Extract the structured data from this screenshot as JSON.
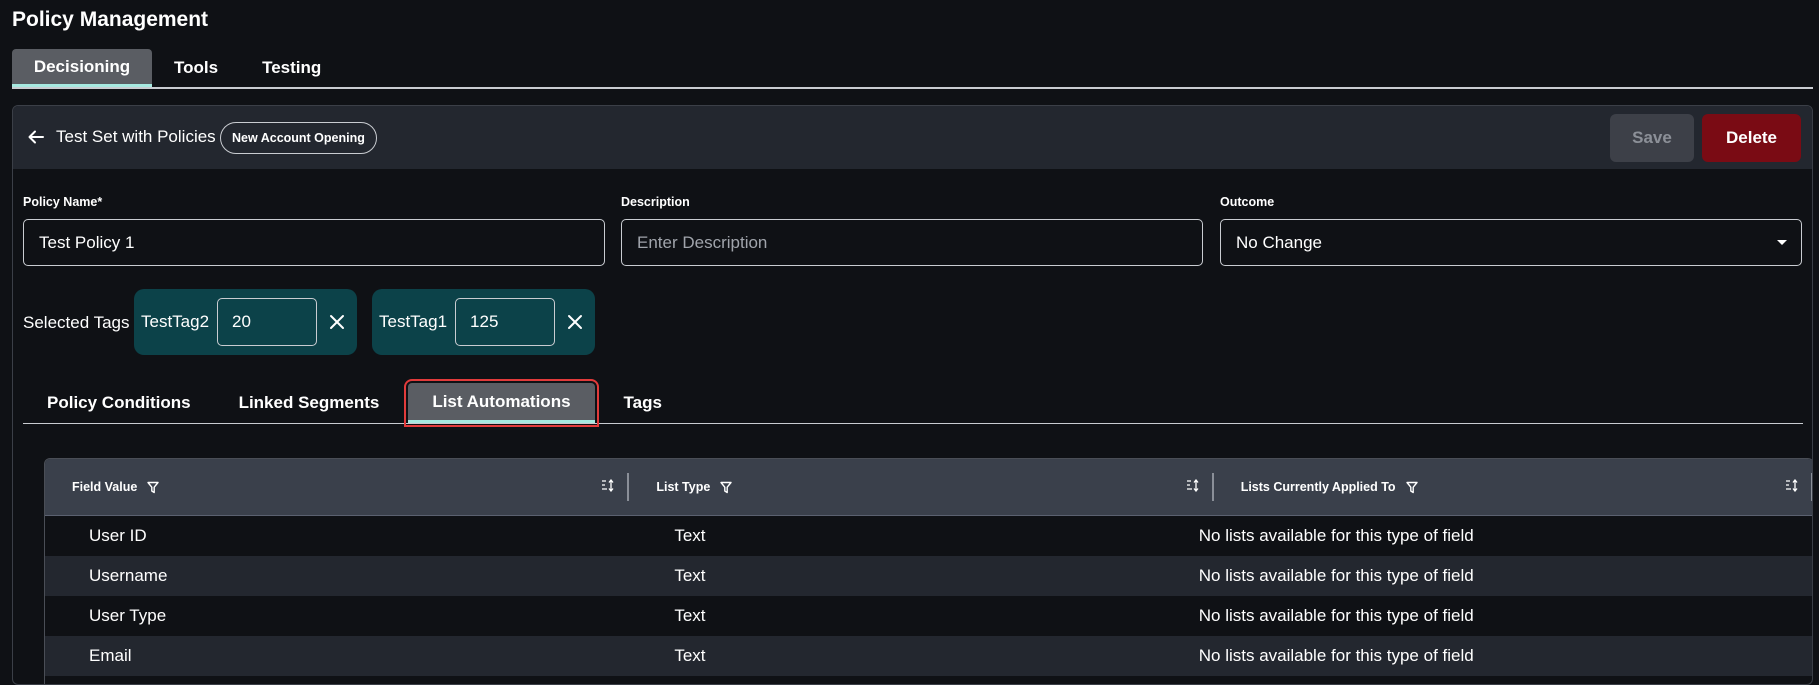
{
  "page_title": "Policy Management",
  "main_tabs": [
    {
      "label": "Decisioning",
      "active": true
    },
    {
      "label": "Tools",
      "active": false
    },
    {
      "label": "Testing",
      "active": false
    }
  ],
  "header": {
    "set_title": "Test Set with Policies",
    "badge": "New Account Opening",
    "save_label": "Save",
    "delete_label": "Delete"
  },
  "form": {
    "policy_name_label": "Policy Name*",
    "policy_name_value": "Test Policy 1",
    "description_label": "Description",
    "description_placeholder": "Enter Description",
    "outcome_label": "Outcome",
    "outcome_value": "No Change"
  },
  "tags": {
    "label": "Selected Tags",
    "items": [
      {
        "name": "TestTag2",
        "value": "20"
      },
      {
        "name": "TestTag1",
        "value": "125"
      }
    ]
  },
  "sub_tabs": [
    {
      "label": "Policy Conditions",
      "active": false
    },
    {
      "label": "Linked Segments",
      "active": false
    },
    {
      "label": "List Automations",
      "active": true
    },
    {
      "label": "Tags",
      "active": false
    }
  ],
  "grid": {
    "columns": [
      "Field Value",
      "List Type",
      "Lists Currently Applied To"
    ],
    "rows": [
      [
        "User ID",
        "Text",
        "No lists available for this type of field"
      ],
      [
        "Username",
        "Text",
        "No lists available for this type of field"
      ],
      [
        "User Type",
        "Text",
        "No lists available for this type of field"
      ],
      [
        "Email",
        "Text",
        "No lists available for this type of field"
      ]
    ]
  },
  "colors": {
    "background": "#0f1115",
    "header_bg": "#23272f",
    "tab_active_bg": "#5a5d63",
    "tab_underline": "#a6e9e0",
    "tag_chip_bg": "#0c4249",
    "delete_bg": "#7a0b14",
    "highlight_outline": "#e23b3b"
  }
}
